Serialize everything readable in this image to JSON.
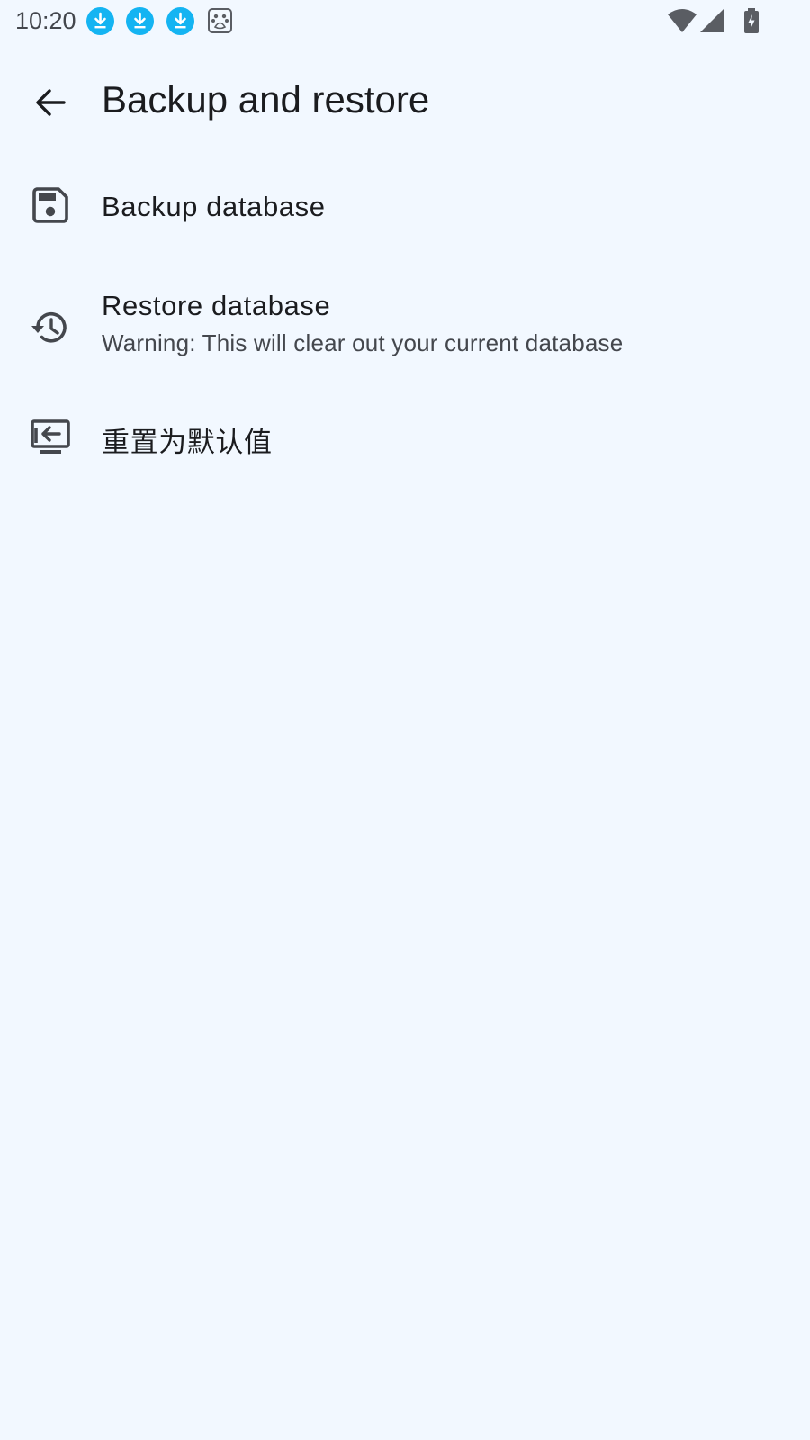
{
  "status_bar": {
    "time": "10:20",
    "notification_icons": [
      "download-icon",
      "download-icon",
      "download-icon",
      "baidu-icon"
    ],
    "system_icons": [
      "wifi-icon",
      "cell-signal-icon",
      "battery-charging-icon"
    ],
    "notification_color": "#14b4f2"
  },
  "toolbar": {
    "back_icon": "arrow-back-icon",
    "title": "Backup and restore"
  },
  "preferences": [
    {
      "icon": "save-icon",
      "title": "Backup database",
      "summary": ""
    },
    {
      "icon": "history-icon",
      "title": "Restore database",
      "summary": "Warning: This will clear out your current database"
    },
    {
      "icon": "reset-screen-icon",
      "title": "重置为默认值",
      "summary": ""
    }
  ],
  "colors": {
    "background": "#f2f8ff",
    "text_primary": "#1b1c1f",
    "text_secondary": "#44474d",
    "icon": "#44474d"
  }
}
